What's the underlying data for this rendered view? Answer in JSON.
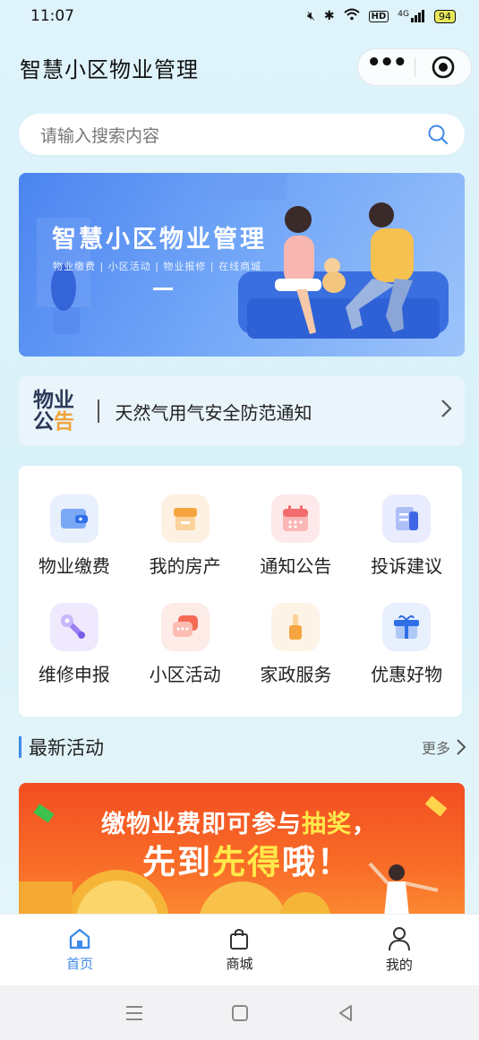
{
  "status_bar": {
    "time": "11:07",
    "hd": "HD",
    "network": "4G",
    "battery": "94"
  },
  "title_bar": {
    "title": "智慧小区物业管理"
  },
  "search": {
    "placeholder": "请输入搜索内容"
  },
  "banner": {
    "title": "智慧小区物业管理",
    "subtitle": "物业缴费 | 小区活动 | 物业报修 | 在线商城"
  },
  "notice": {
    "logo_line1": "物业",
    "logo_line2_a": "公",
    "logo_line2_b": "告",
    "text": "天然气用气安全防范通知"
  },
  "grid": {
    "items": [
      {
        "label": "物业缴费",
        "icon": "wallet-icon",
        "color": "#4f8ff0"
      },
      {
        "label": "我的房产",
        "icon": "house-icon",
        "color": "#f5a53f"
      },
      {
        "label": "通知公告",
        "icon": "calendar-icon",
        "color": "#f46b6b"
      },
      {
        "label": "投诉建议",
        "icon": "document-icon",
        "color": "#5b7ff0"
      },
      {
        "label": "维修申报",
        "icon": "wrench-icon",
        "color": "#8a6bf0"
      },
      {
        "label": "小区活动",
        "icon": "chat-icon",
        "color": "#f56a55"
      },
      {
        "label": "家政服务",
        "icon": "broom-icon",
        "color": "#f5a53f"
      },
      {
        "label": "优惠好物",
        "icon": "gift-icon",
        "color": "#4f8ff0"
      }
    ]
  },
  "section": {
    "title": "最新活动",
    "more": "更多"
  },
  "promo": {
    "line1_a": "缴物业费即可参与",
    "line1_b": "抽奖",
    "line1_c": "，",
    "line2_a": "先到",
    "line2_b": "先得",
    "line2_c": "哦！"
  },
  "tabbar": {
    "tabs": [
      {
        "label": "首页",
        "icon": "home-icon"
      },
      {
        "label": "商城",
        "icon": "shopping-bag-icon"
      },
      {
        "label": "我的",
        "icon": "user-icon"
      }
    ]
  },
  "colors": {
    "accent": "#3f8ae8",
    "promo": "#f24e21",
    "highlight": "#ffe94a"
  }
}
